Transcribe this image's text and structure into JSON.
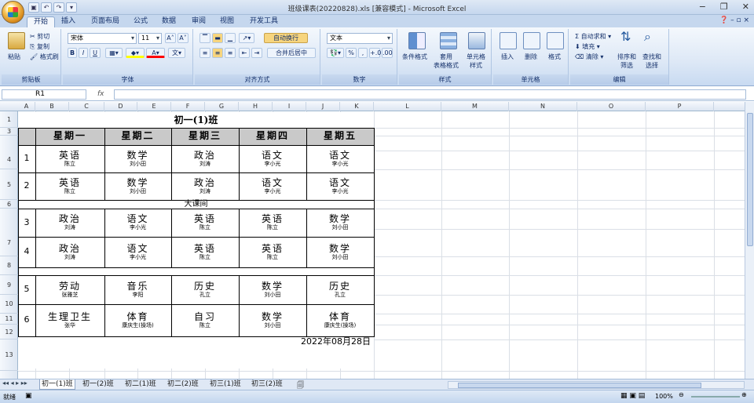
{
  "window": {
    "title": "班级课表(20220828).xls [兼容模式] - Microsoft Excel"
  },
  "ribbon_tabs": [
    "开始",
    "插入",
    "页面布局",
    "公式",
    "数据",
    "审阅",
    "视图",
    "开发工具"
  ],
  "clipboard": {
    "paste": "粘贴",
    "cut": "剪切",
    "copy": "复制",
    "format_painter": "格式刷",
    "label": "剪贴板"
  },
  "font": {
    "name": "宋体",
    "size": "11",
    "label": "字体"
  },
  "alignment": {
    "wrap": "自动换行",
    "merge": "合并后居中",
    "label": "对齐方式"
  },
  "number": {
    "format": "文本",
    "label": "数字"
  },
  "styles": {
    "cond": "条件格式",
    "table": "套用\n表格格式",
    "cell": "单元格\n样式",
    "label": "样式"
  },
  "cells": {
    "insert": "插入",
    "delete": "删除",
    "format": "格式",
    "label": "单元格"
  },
  "editing": {
    "autosum": "自动求和",
    "fill": "填充",
    "clear": "清除",
    "sort": "排序和\n筛选",
    "find": "查找和\n选择",
    "label": "编辑"
  },
  "formula_bar": {
    "name_box": "R1",
    "fx": "fx",
    "value": ""
  },
  "columns": [
    "A",
    "B",
    "C",
    "D",
    "E",
    "F",
    "G",
    "H",
    "I",
    "J",
    "K",
    "L",
    "M",
    "N",
    "O",
    "P"
  ],
  "rows": [
    "1",
    "3",
    "4",
    "5",
    "6",
    "7",
    "8",
    "9",
    "10",
    "11",
    "12",
    "13"
  ],
  "timetable": {
    "title": "初一(1)班",
    "days": [
      "星期一",
      "星期二",
      "星期三",
      "星期四",
      "星期五"
    ],
    "periods": [
      {
        "num": "1",
        "cells": [
          [
            "英语",
            "陈立"
          ],
          [
            "数学",
            "刘小田"
          ],
          [
            "政治",
            "刘涛"
          ],
          [
            "语文",
            "李小光"
          ],
          [
            "语文",
            "李小光"
          ]
        ]
      },
      {
        "num": "2",
        "cells": [
          [
            "英语",
            "陈立"
          ],
          [
            "数学",
            "刘小田"
          ],
          [
            "政治",
            "刘涛"
          ],
          [
            "语文",
            "李小光"
          ],
          [
            "语文",
            "李小光"
          ]
        ]
      },
      {
        "num": "3",
        "cells": [
          [
            "政治",
            "刘涛"
          ],
          [
            "语文",
            "李小光"
          ],
          [
            "英语",
            "陈立"
          ],
          [
            "英语",
            "陈立"
          ],
          [
            "数学",
            "刘小田"
          ]
        ]
      },
      {
        "num": "4",
        "cells": [
          [
            "政治",
            "刘涛"
          ],
          [
            "语文",
            "李小光"
          ],
          [
            "英语",
            "陈立"
          ],
          [
            "英语",
            "陈立"
          ],
          [
            "数学",
            "刘小田"
          ]
        ]
      },
      {
        "num": "5",
        "cells": [
          [
            "劳动",
            "张雅芝"
          ],
          [
            "音乐",
            "李阳"
          ],
          [
            "历史",
            "孔立"
          ],
          [
            "数学",
            "刘小田"
          ],
          [
            "历史",
            "孔立"
          ]
        ]
      },
      {
        "num": "6",
        "cells": [
          [
            "生理卫生",
            "张华"
          ],
          [
            "体育",
            "康庆生(操场)"
          ],
          [
            "自习",
            "陈立"
          ],
          [
            "数学",
            "刘小田"
          ],
          [
            "体育",
            "康庆生(操场)"
          ]
        ]
      }
    ],
    "break": "大课间",
    "date": "2022年08月28日"
  },
  "sheets": [
    "初一(1)班",
    "初一(2)班",
    "初二(1)班",
    "初二(2)班",
    "初三(1)班",
    "初三(2)班"
  ],
  "status": {
    "ready": "就绪",
    "zoom": "100%"
  }
}
